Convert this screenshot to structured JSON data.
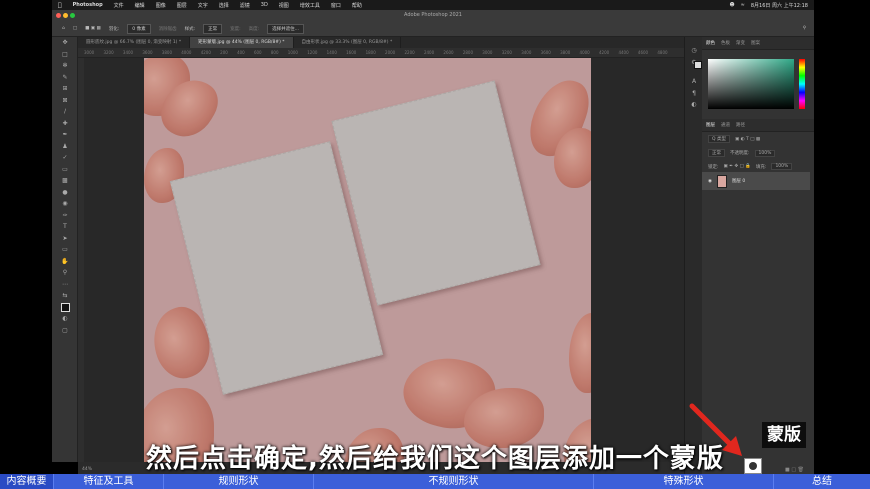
{
  "menubar": {
    "app": "Photoshop",
    "items": [
      "文件",
      "编辑",
      "图像",
      "图层",
      "文字",
      "选择",
      "滤镜",
      "3D",
      "视图",
      "增效工具",
      "窗口",
      "帮助"
    ],
    "clock": "8月16日 周六 上午12:18"
  },
  "window": {
    "title": "Adobe Photoshop 2021"
  },
  "options": {
    "feather_label": "羽化:",
    "feather_value": "0 像素",
    "antialias": "消除锯齿",
    "style_label": "样式:",
    "style_value": "正常",
    "width_label": "宽度:",
    "height_label": "高度:",
    "select_mask": "选择并遮住..."
  },
  "tabs": [
    {
      "label": "圆形底纹.jpg @ 66.7% (图层 0, 渐变映射 1) *",
      "active": false
    },
    {
      "label": "矩形蒙版.jpg @ 44% (图层 0, RGB/8#) *",
      "active": true
    },
    {
      "label": "自由形状.jpg @ 33.3% (图层 0, RGB/8#) *",
      "active": false
    }
  ],
  "ruler": "3000 3200 3400 3600 3800 4000 4200 200 400 600 800 1000 1200 1400 1600 1800 2000 2200 2400 2600 2800 3000 3200 3400 3600 3800 4000 4200 4400 4600 4800",
  "status": {
    "zoom": "44%"
  },
  "panels": {
    "top_tabs": [
      "颜色",
      "色板",
      "渐变",
      "图案"
    ],
    "layer_tabs": [
      "图层",
      "通道",
      "路径"
    ],
    "filter_label": "Q 类型",
    "blend_mode": "正常",
    "opacity_label": "不透明度:",
    "opacity_value": "100%",
    "lock_label": "锁定:",
    "fill_label": "填充:",
    "fill_value": "100%",
    "layer_name": "图层 0"
  },
  "annotation": {
    "subtitle": "然后点击确定,然后给我们这个图层添加一个蒙版",
    "callout": "蒙版"
  },
  "chapters": [
    {
      "label": "内容概要",
      "active": true
    },
    {
      "label": "特征及工具",
      "active": false
    },
    {
      "label": "规则形状",
      "active": false
    },
    {
      "label": "不规则形状",
      "active": false
    },
    {
      "label": "特殊形状",
      "active": false
    },
    {
      "label": "总结",
      "active": false
    }
  ],
  "colors": {
    "chapter_bar": "#3b5fd9",
    "canvas_bg": "#d9b0b0",
    "arrow": "#e0271e"
  }
}
